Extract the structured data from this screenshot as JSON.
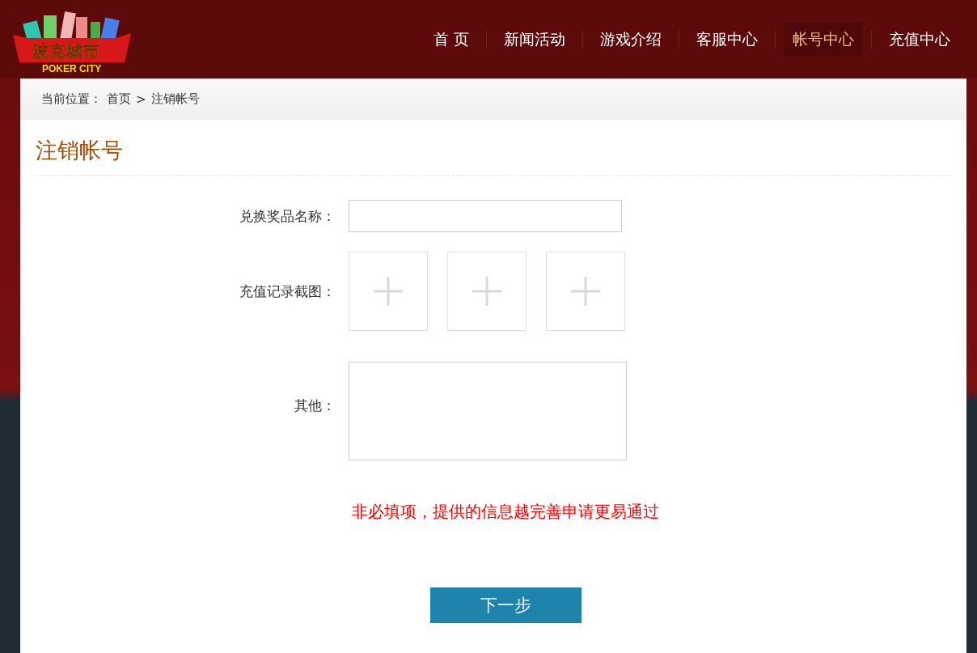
{
  "logo": {
    "title": "波克城市",
    "subtitle": "POKER CITY"
  },
  "nav": [
    {
      "label": "首 页",
      "selected": false
    },
    {
      "label": "新闻活动",
      "selected": false
    },
    {
      "label": "游戏介绍",
      "selected": false
    },
    {
      "label": "客服中心",
      "selected": false
    },
    {
      "label": "帐号中心",
      "selected": true
    },
    {
      "label": "充值中心",
      "selected": false
    }
  ],
  "breadcrumb": {
    "prefix": "当前位置：",
    "items": [
      "首页",
      ">",
      "注销帐号"
    ]
  },
  "page_title": "注销帐号",
  "form": {
    "prize_label": "兑换奖品名称：",
    "screenshot_label": "充值记录截图：",
    "other_label": "其他："
  },
  "note": "非必填项，提供的信息越完善申请更易通过",
  "next_button": "下一步"
}
